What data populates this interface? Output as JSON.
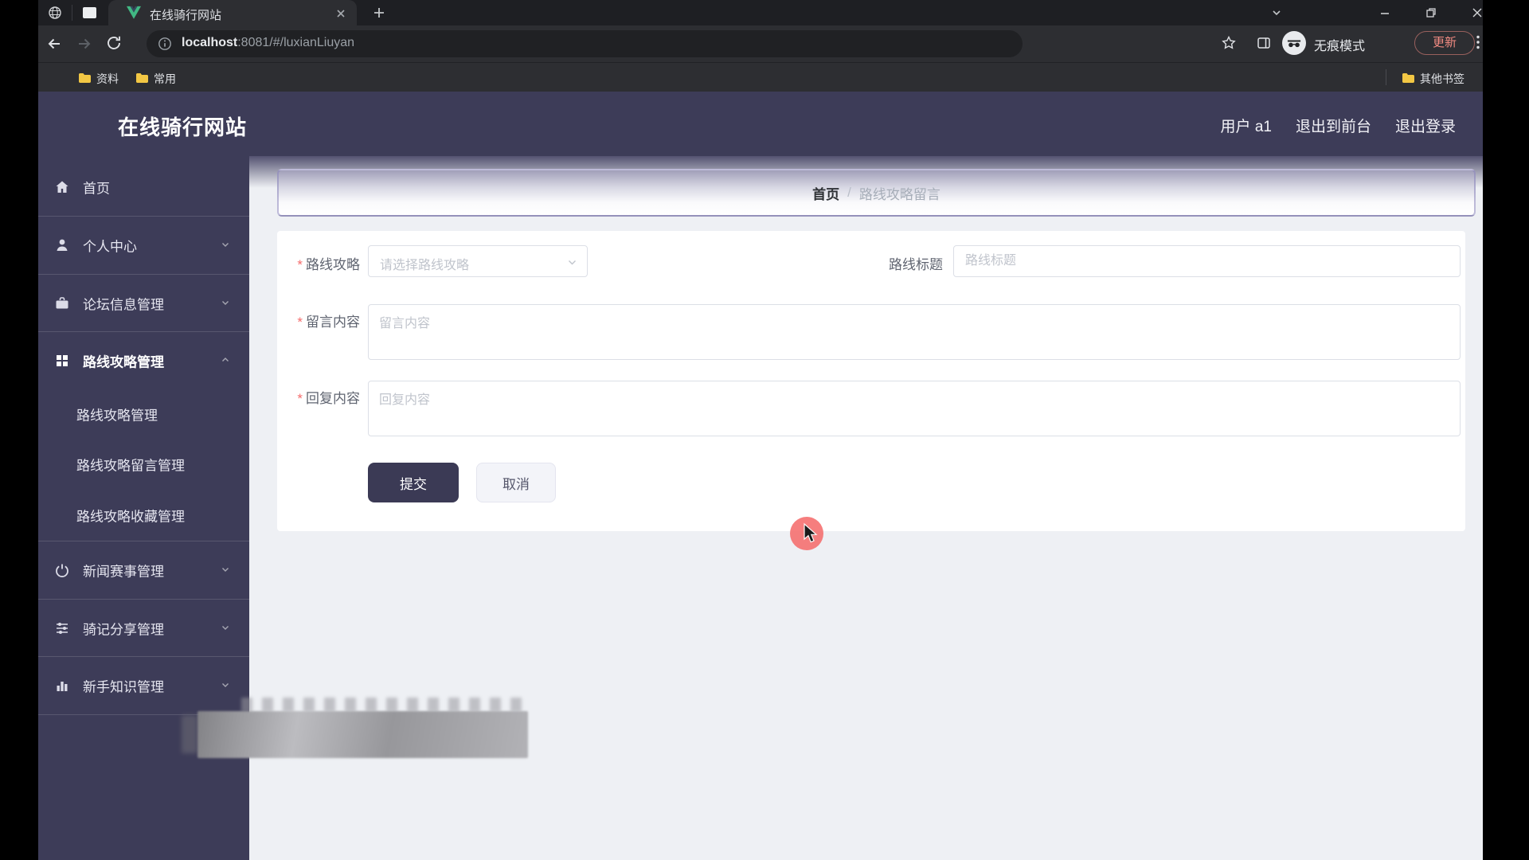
{
  "browser": {
    "tab": {
      "title": "在线骑行网站"
    },
    "url": {
      "host": "localhost",
      "rest": ":8081/#/luxianLiuyan"
    },
    "incognito_label": "无痕模式",
    "update_button": "更新",
    "bookmarks": {
      "folder1": "资料",
      "folder2": "常用",
      "other": "其他书签"
    }
  },
  "app": {
    "title": "在线骑行网站",
    "header_right": {
      "user": "用户 a1",
      "to_front": "退出到前台",
      "logout": "退出登录"
    }
  },
  "sidebar": {
    "items": [
      {
        "label": "首页"
      },
      {
        "label": "个人中心"
      },
      {
        "label": "论坛信息管理"
      },
      {
        "label": "路线攻略管理"
      },
      {
        "label": "路线攻略管理"
      },
      {
        "label": "路线攻略留言管理"
      },
      {
        "label": "路线攻略收藏管理"
      },
      {
        "label": "新闻赛事管理"
      },
      {
        "label": "骑记分享管理"
      },
      {
        "label": "新手知识管理"
      }
    ]
  },
  "breadcrumb": {
    "home": "首页",
    "separator": "/",
    "current": "路线攻略留言"
  },
  "form": {
    "required_mark": "*",
    "route_label": "路线攻略",
    "route_placeholder": "请选择路线攻略",
    "title_label": "路线标题",
    "title_placeholder": "路线标题",
    "message_label": "留言内容",
    "message_placeholder": "留言内容",
    "reply_label": "回复内容",
    "reply_placeholder": "回复内容",
    "submit": "提交",
    "cancel": "取消"
  },
  "colors": {
    "sidebar_navy": "#3d3c58",
    "content_bg": "#eef0f4",
    "required_red": "#f56c6c",
    "update_red": "#f28b82",
    "folder_yellow": "#f2c744",
    "vue_green": "#41b883",
    "cursor_highlight": "#f56c6c"
  }
}
